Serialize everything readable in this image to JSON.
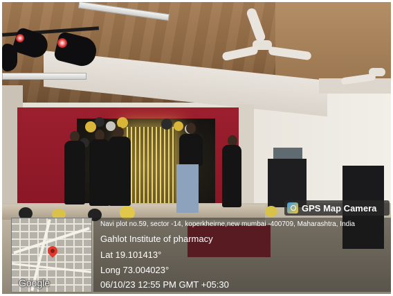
{
  "gps_overlay": {
    "app_name": "GPS Map Camera",
    "address": "Navi plot no.59, sector -14, koperkheirne,new mumbai -400709, Maharashtra, India",
    "place_name": "Gahlot Institute of pharmacy",
    "latitude": "Lat 19.101413°",
    "longitude": "Long 73.004023°",
    "datetime": "06/10/23 12:55 PM GMT +05:30",
    "map_logo": "Google",
    "icons": [
      "gps-map-camera-icon",
      "map-pin-icon"
    ]
  },
  "colors": {
    "curtain": "#9c1f2e",
    "ceiling": "#8e6843",
    "fairy_lights": "#f0c83c",
    "overlay_text": "#ffffff"
  }
}
